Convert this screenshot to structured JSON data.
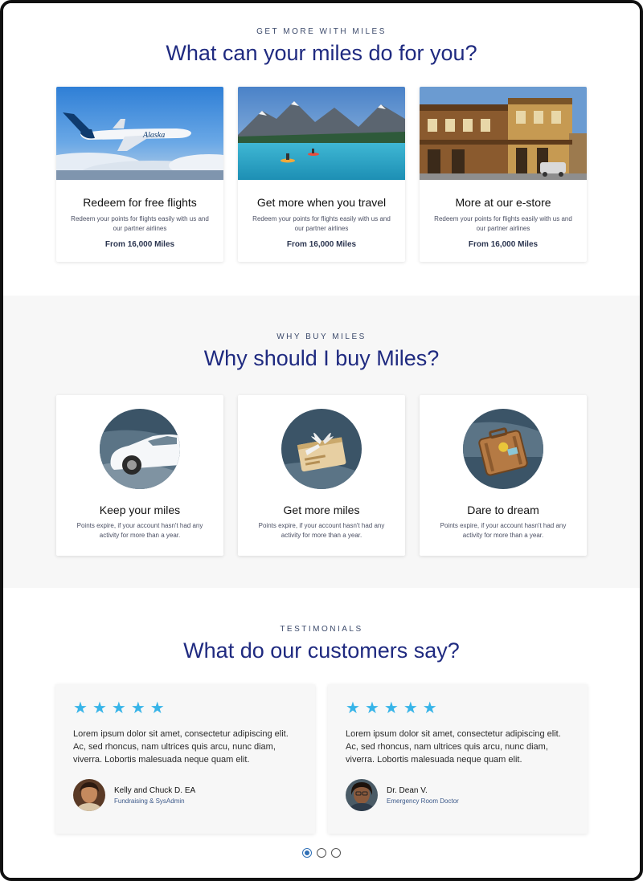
{
  "redeem": {
    "eyebrow": "GET MORE WITH MILES",
    "heading": "What can your miles do for you?",
    "cards": [
      {
        "title": "Redeem for free flights",
        "desc": "Redeem your points for flights easily with us and our partner airlines",
        "price": "From 16,000 Miles",
        "brand": "Alaska"
      },
      {
        "title": "Get more when you travel",
        "desc": "Redeem your points for flights easily with us and our partner airlines",
        "price": "From 16,000 Miles"
      },
      {
        "title": "More at our e-store",
        "desc": "Redeem your points for flights easily with us and our partner airlines",
        "price": "From 16,000 Miles"
      }
    ]
  },
  "why": {
    "eyebrow": "WHY BUY MILES",
    "heading": "Why should I buy Miles?",
    "cards": [
      {
        "title": "Keep your miles",
        "desc": "Points expire, if your account hasn't had any activity for more than a year.",
        "icon": "car-icon"
      },
      {
        "title": "Get more miles",
        "desc": "Points expire, if your account hasn't had any activity for more than a year.",
        "icon": "gift-card-icon"
      },
      {
        "title": "Dare to dream",
        "desc": "Points expire, if your account hasn't had any activity for more than a year.",
        "icon": "suitcase-icon"
      }
    ]
  },
  "testimonials": {
    "eyebrow": "TESTIMONIALS",
    "heading": "What do our customers say?",
    "items": [
      {
        "rating": 5,
        "quote": "Lorem ipsum dolor sit amet, consectetur adipiscing elit. Ac, sed rhoncus, nam ultrices quis arcu, nunc diam, viverra. Lobortis malesuada neque quam elit.",
        "name": "Kelly and Chuck D. EA",
        "role": "Fundraising & SysAdmin"
      },
      {
        "rating": 5,
        "quote": "Lorem ipsum dolor sit amet, consectetur adipiscing elit. Ac, sed rhoncus, nam ultrices quis arcu, nunc diam, viverra. Lobortis malesuada neque quam elit.",
        "name": "Dr. Dean V.",
        "role": "Emergency Room Doctor"
      }
    ],
    "pagination": {
      "pages": 3,
      "active": 1
    }
  },
  "colors": {
    "accent": "#1f2a80",
    "star": "#37b4e8",
    "dot_active": "#2f6fb6",
    "icon_circle": "#3b5467"
  }
}
